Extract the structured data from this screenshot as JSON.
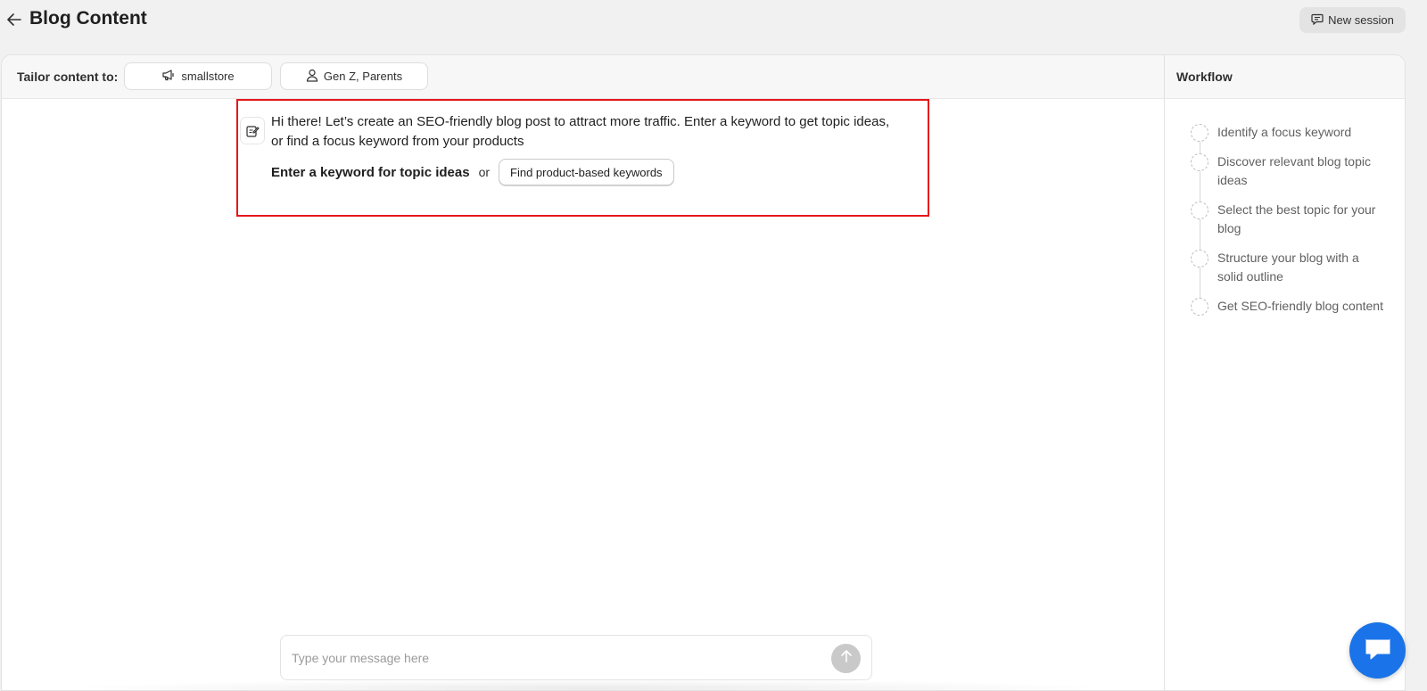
{
  "header": {
    "title": "Blog Content",
    "new_session_label": "New session"
  },
  "tailor": {
    "label": "Tailor content to:",
    "store": "smallstore",
    "audience": "Gen Z, Parents"
  },
  "message": {
    "text": "Hi there! Let’s create an SEO-friendly blog post to attract more traffic. Enter a keyword to get topic ideas, or find a focus keyword from your products",
    "keyword_link": "Enter a keyword for topic ideas",
    "or": "or",
    "find_button": "Find product-based keywords"
  },
  "input": {
    "placeholder": "Type your message here"
  },
  "workflow": {
    "title": "Workflow",
    "steps": [
      "Identify a focus keyword",
      "Discover relevant blog topic ideas",
      "Select the best topic for your blog",
      "Structure your blog with a solid outline",
      "Get SEO-friendly blog content"
    ]
  },
  "colors": {
    "highlight": "#e5161b",
    "chat_fab": "#1a73e8",
    "send_button": "#c9c9c9"
  }
}
